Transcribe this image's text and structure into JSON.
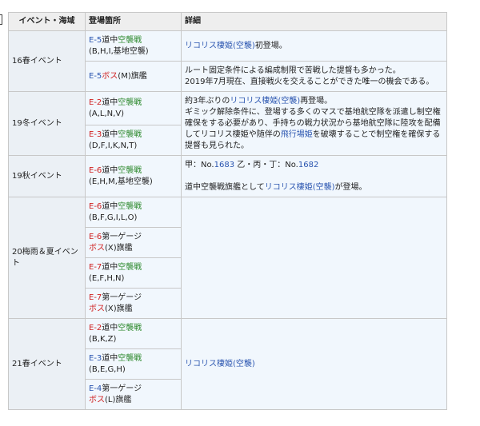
{
  "header": {
    "event": "イベント・海域",
    "location": "登場箇所",
    "detail": "詳細"
  },
  "events": {
    "e16": "16春イベント",
    "e19w": "19冬イベント",
    "e19a": "19秋イベント",
    "e20": "20梅雨＆夏イベント",
    "e21": "21春イベント"
  },
  "common": {
    "dotyu": "道中",
    "kushu": "空襲戦",
    "boss": "ボス",
    "kikan": "旗艦",
    "dai1": "第一ゲージ"
  },
  "rows": {
    "r1": {
      "stage": "E-5",
      "nodes": "(B,H,I,基地空襲)"
    },
    "r2": {
      "stage": "E-5",
      "nodes": "(M)"
    },
    "r3": {
      "stage": "E-2",
      "nodes": "(A,L,N,V)"
    },
    "r4": {
      "stage": "E-3",
      "nodes": "(D,F,I,K,N,T)"
    },
    "r5": {
      "stage": "E-6",
      "nodes": "(E,H,M,基地空襲)"
    },
    "r6": {
      "stage": "E-6",
      "nodes": "(B,F,G,I,L,O)"
    },
    "r7": {
      "stage": "E-6",
      "nodes": "(X)"
    },
    "r8": {
      "stage": "E-7",
      "nodes": "(E,F,H,N)"
    },
    "r9": {
      "stage": "E-7",
      "nodes": "(X)"
    },
    "r10": {
      "stage": "E-2",
      "nodes": "(B,K,Z)"
    },
    "r11": {
      "stage": "E-3",
      "nodes": "(B,E,G,H)"
    },
    "r12": {
      "stage": "E-4",
      "nodes": "(L)"
    }
  },
  "details": {
    "d1": {
      "link": "リコリス棲姫(空襲)",
      "suffix": "初登場。"
    },
    "d2": {
      "line1": "ルート固定条件による編成制限で苦戦した提督も多かった。",
      "line2": "2019年7月現在、直接戦火を交えることができた唯一の機会である。"
    },
    "d3": {
      "prefix": "約3年ぶりの",
      "link": "リコリス棲姫(空襲)",
      "suffix": "再登場。",
      "body1": "ギミック解除条件に、登場する多くのマスで基地航空隊を派遣し制空権確保をする必要があり、手持ちの戦力状況から基地航空隊に陸攻を配備してリコリス棲姫や随伴の",
      "link2": "飛行場姫",
      "body2": "を破壊することで制空権を確保する提督も見られた。"
    },
    "d4": {
      "kou": "甲：No.",
      "num1": "1683",
      "otsu": "乙・丙・丁：No.",
      "num2": "1682",
      "line2prefix": "道中空襲戦旗艦として",
      "link": "リコリス棲姫(空襲)",
      "line2suffix": "が登場。"
    },
    "d5": {
      "link": "リコリス棲姫(空襲)"
    }
  },
  "colors": {
    "link": "#2a55b0",
    "air_raid": "#2e8a2e",
    "boss": "#d02020",
    "header_bg": "#eeeeee",
    "cell_bg": "#f1f7fd"
  }
}
